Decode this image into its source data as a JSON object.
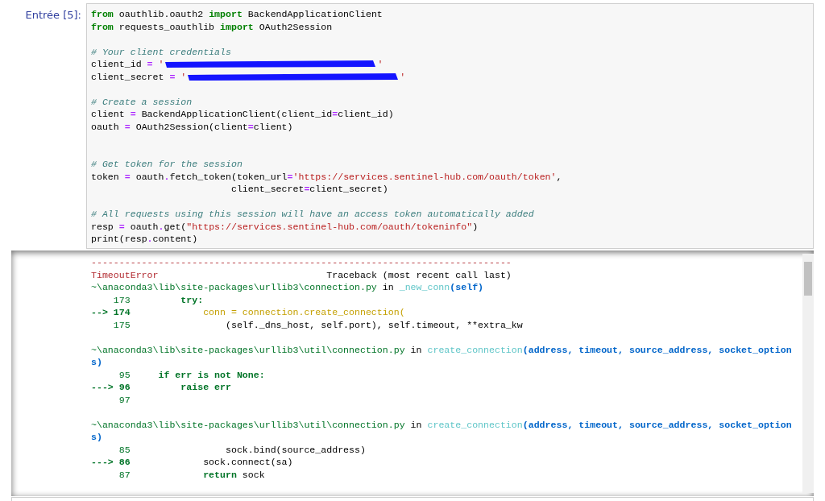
{
  "cell": {
    "prompt": "Entrée [5]:",
    "code_lines": [
      {
        "kind": "code",
        "tokens": [
          {
            "text": "from",
            "kind": "kw"
          },
          {
            "text": " oauthlib.oauth2 ",
            "kind": "plain"
          },
          {
            "text": "import",
            "kind": "kw"
          },
          {
            "text": " BackendApplicationClient",
            "kind": "plain"
          }
        ]
      },
      {
        "kind": "code",
        "tokens": [
          {
            "text": "from",
            "kind": "kw"
          },
          {
            "text": " requests_oauthlib ",
            "kind": "plain"
          },
          {
            "text": "import",
            "kind": "kw"
          },
          {
            "text": " OAuth2Session",
            "kind": "plain"
          }
        ]
      },
      {
        "kind": "blank"
      },
      {
        "kind": "code",
        "tokens": [
          {
            "text": "# Your client credentials",
            "kind": "comment"
          }
        ]
      },
      {
        "kind": "code",
        "tokens": [
          {
            "text": "client_id ",
            "kind": "plain"
          },
          {
            "text": "=",
            "kind": "op"
          },
          {
            "text": " '",
            "kind": "str"
          },
          {
            "kind": "redacted"
          },
          {
            "text": "'",
            "kind": "str"
          }
        ]
      },
      {
        "kind": "code",
        "tokens": [
          {
            "text": "client_secret ",
            "kind": "plain"
          },
          {
            "text": "=",
            "kind": "op"
          },
          {
            "text": " '",
            "kind": "str"
          },
          {
            "kind": "redacted"
          },
          {
            "text": "'",
            "kind": "str"
          }
        ]
      },
      {
        "kind": "blank"
      },
      {
        "kind": "code",
        "tokens": [
          {
            "text": "# Create a session",
            "kind": "comment"
          }
        ]
      },
      {
        "kind": "code",
        "tokens": [
          {
            "text": "client ",
            "kind": "plain"
          },
          {
            "text": "=",
            "kind": "op"
          },
          {
            "text": " BackendApplicationClient(client_id",
            "kind": "plain"
          },
          {
            "text": "=",
            "kind": "op"
          },
          {
            "text": "client_id)",
            "kind": "plain"
          }
        ]
      },
      {
        "kind": "code",
        "tokens": [
          {
            "text": "oauth ",
            "kind": "plain"
          },
          {
            "text": "=",
            "kind": "op"
          },
          {
            "text": " OAuth2Session(client",
            "kind": "plain"
          },
          {
            "text": "=",
            "kind": "op"
          },
          {
            "text": "client)",
            "kind": "plain"
          }
        ]
      },
      {
        "kind": "blank"
      },
      {
        "kind": "blank"
      },
      {
        "kind": "code",
        "tokens": [
          {
            "text": "# Get token for the session",
            "kind": "comment"
          }
        ]
      },
      {
        "kind": "code",
        "tokens": [
          {
            "text": "token ",
            "kind": "plain"
          },
          {
            "text": "=",
            "kind": "op"
          },
          {
            "text": " oauth",
            "kind": "plain"
          },
          {
            "text": ".",
            "kind": "op"
          },
          {
            "text": "fetch_token(token_url",
            "kind": "plain"
          },
          {
            "text": "=",
            "kind": "op"
          },
          {
            "text": "'https://services.sentinel-hub.com/oauth/token'",
            "kind": "str"
          },
          {
            "text": ",",
            "kind": "plain"
          }
        ]
      },
      {
        "kind": "code",
        "tokens": [
          {
            "text": "                         client_secret",
            "kind": "plain"
          },
          {
            "text": "=",
            "kind": "op"
          },
          {
            "text": "client_secret)",
            "kind": "plain"
          }
        ]
      },
      {
        "kind": "blank"
      },
      {
        "kind": "code",
        "tokens": [
          {
            "text": "# All requests using this session will have an access token automatically added",
            "kind": "comment"
          }
        ]
      },
      {
        "kind": "code",
        "tokens": [
          {
            "text": "resp ",
            "kind": "plain"
          },
          {
            "text": "=",
            "kind": "op"
          },
          {
            "text": " oauth",
            "kind": "plain"
          },
          {
            "text": ".",
            "kind": "op"
          },
          {
            "text": "get(",
            "kind": "plain"
          },
          {
            "text": "\"https://services.sentinel-hub.com/oauth/tokeninfo\"",
            "kind": "str"
          },
          {
            "text": ")",
            "kind": "plain"
          }
        ]
      },
      {
        "kind": "code",
        "tokens": [
          {
            "text": "print",
            "kind": "plain"
          },
          {
            "text": "(resp",
            "kind": "plain"
          },
          {
            "text": ".",
            "kind": "op"
          },
          {
            "text": "content)",
            "kind": "plain"
          }
        ]
      }
    ],
    "output_lines": [
      {
        "kind": "code",
        "tokens": [
          {
            "text": "---------------------------------------------------------------------------",
            "kind": "error"
          }
        ]
      },
      {
        "kind": "code",
        "tokens": [
          {
            "text": "TimeoutError",
            "kind": "error"
          },
          {
            "text": "                              Traceback (most recent call last)",
            "kind": "plain"
          }
        ]
      },
      {
        "kind": "code",
        "tokens": [
          {
            "text": "~\\anaconda3\\lib\\site-packages\\urllib3\\connection.py",
            "kind": "path"
          },
          {
            "text": " in ",
            "kind": "plain"
          },
          {
            "text": "_new_conn",
            "kind": "func"
          },
          {
            "text": "(self)",
            "kind": "args"
          }
        ]
      },
      {
        "kind": "code",
        "tokens": [
          {
            "text": "    173",
            "kind": "lineno"
          },
          {
            "text": "         try:",
            "kind": "keyword"
          }
        ]
      },
      {
        "kind": "code",
        "tokens": [
          {
            "text": "--> 174",
            "kind": "arrow"
          },
          {
            "text": "             conn = connection.create_connection(",
            "kind": "code"
          }
        ]
      },
      {
        "kind": "code",
        "tokens": [
          {
            "text": "    175",
            "kind": "lineno"
          },
          {
            "text": "                 (self._dns_host, self.port), self.timeout, **extra_kw",
            "kind": "plain"
          }
        ]
      },
      {
        "kind": "blank"
      },
      {
        "kind": "code",
        "tokens": [
          {
            "text": "~\\anaconda3\\lib\\site-packages\\urllib3\\util\\connection.py",
            "kind": "path"
          },
          {
            "text": " in ",
            "kind": "plain"
          },
          {
            "text": "create_connection",
            "kind": "func"
          },
          {
            "text": "(address, timeout, source_address, socket_option",
            "kind": "args"
          }
        ]
      },
      {
        "kind": "code",
        "tokens": [
          {
            "text": "s)",
            "kind": "args"
          }
        ]
      },
      {
        "kind": "code",
        "tokens": [
          {
            "text": "     95",
            "kind": "lineno"
          },
          {
            "text": "     if err is not None:",
            "kind": "keyword"
          }
        ]
      },
      {
        "kind": "code",
        "tokens": [
          {
            "text": "---> 96",
            "kind": "arrow"
          },
          {
            "text": "         raise",
            "kind": "keyword"
          },
          {
            "text": " err",
            "kind": "keyword"
          }
        ]
      },
      {
        "kind": "code",
        "tokens": [
          {
            "text": "     97",
            "kind": "lineno"
          }
        ]
      },
      {
        "kind": "blank"
      },
      {
        "kind": "code",
        "tokens": [
          {
            "text": "~\\anaconda3\\lib\\site-packages\\urllib3\\util\\connection.py",
            "kind": "path"
          },
          {
            "text": " in ",
            "kind": "plain"
          },
          {
            "text": "create_connection",
            "kind": "func"
          },
          {
            "text": "(address, timeout, source_address, socket_option",
            "kind": "args"
          }
        ]
      },
      {
        "kind": "code",
        "tokens": [
          {
            "text": "s)",
            "kind": "args"
          }
        ]
      },
      {
        "kind": "code",
        "tokens": [
          {
            "text": "     85",
            "kind": "lineno"
          },
          {
            "text": "                 sock.bind(source_address)",
            "kind": "plain"
          }
        ]
      },
      {
        "kind": "code",
        "tokens": [
          {
            "text": "---> 86",
            "kind": "arrow"
          },
          {
            "text": "             sock.connect(sa)",
            "kind": "plain"
          }
        ]
      },
      {
        "kind": "code",
        "tokens": [
          {
            "text": "     87",
            "kind": "lineno"
          },
          {
            "text": "             return",
            "kind": "keyword"
          },
          {
            "text": " sock",
            "kind": "plain"
          }
        ]
      }
    ]
  }
}
